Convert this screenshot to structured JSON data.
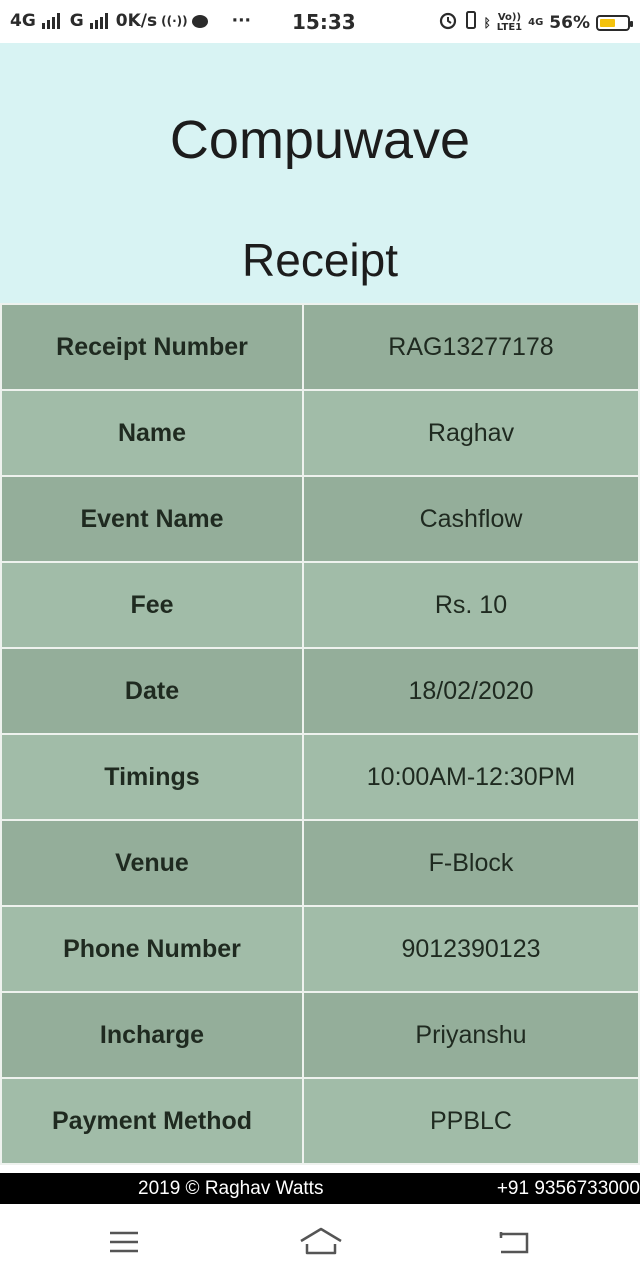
{
  "status_bar": {
    "network1": "4G",
    "network2": "G",
    "speed": "0K/s",
    "time": "15:33",
    "volte_top": "Vo))",
    "volte_bottom": "LTE1",
    "network3": "4G",
    "battery": "56%",
    "battery_level": 0.56,
    "battery_color": "#f4c20d",
    "icons": [
      "signal-icon",
      "hotspot-icon",
      "message-icon",
      "more-icon",
      "alarm-icon",
      "vibrate-icon",
      "bluetooth-icon",
      "battery-icon"
    ]
  },
  "header": {
    "brand": "Compuwave",
    "title": "Receipt",
    "background": "#d8f3f3"
  },
  "receipt": {
    "rows": [
      {
        "label": "Receipt Number",
        "value": "RAG13277178"
      },
      {
        "label": "Name",
        "value": "Raghav"
      },
      {
        "label": "Event Name",
        "value": "Cashflow"
      },
      {
        "label": "Fee",
        "value": "Rs. 10"
      },
      {
        "label": "Date",
        "value": "18/02/2020"
      },
      {
        "label": "Timings",
        "value": "10:00AM-12:30PM"
      },
      {
        "label": "Venue",
        "value": "F-Block"
      },
      {
        "label": "Phone Number",
        "value": "9012390123"
      },
      {
        "label": "Incharge",
        "value": "Priyanshu"
      },
      {
        "label": "Payment Method",
        "value": "PPBLC"
      }
    ],
    "row_colors": [
      "#94ae9a",
      "#a1bca8"
    ]
  },
  "footer": {
    "copyright": "2019 © Raghav Watts",
    "phone": "+91 9356733000"
  },
  "nav_bar": {
    "buttons": [
      "menu-icon",
      "home-icon",
      "back-icon"
    ]
  }
}
